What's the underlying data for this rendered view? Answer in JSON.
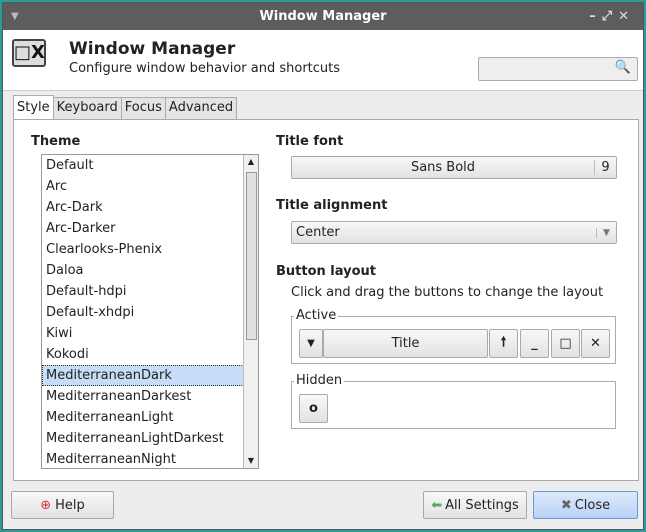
{
  "window": {
    "title": "Window Manager",
    "controls": [
      "–",
      "⤢",
      "✕"
    ]
  },
  "header": {
    "title": "Window Manager",
    "subtitle": "Configure window behavior and shortcuts",
    "search_placeholder": ""
  },
  "tabs": [
    {
      "label": "Style",
      "active": true
    },
    {
      "label": "Keyboard"
    },
    {
      "label": "Focus"
    },
    {
      "label": "Advanced"
    }
  ],
  "theme": {
    "label": "Theme",
    "items": [
      "Default",
      "Arc",
      "Arc-Dark",
      "Arc-Darker",
      "Clearlooks-Phenix",
      "Daloa",
      "Default-hdpi",
      "Default-xhdpi",
      "Kiwi",
      "Kokodi",
      "MediterraneanDark",
      "MediterraneanDarkest",
      "MediterraneanLight",
      "MediterraneanLightDarkest",
      "MediterraneanNight"
    ],
    "selected": "MediterraneanDark"
  },
  "title_font": {
    "label": "Title font",
    "font": "Sans Bold",
    "size": "9"
  },
  "title_alignment": {
    "label": "Title alignment",
    "value": "Center"
  },
  "button_layout": {
    "label": "Button layout",
    "description": "Click and drag the buttons to change the layout",
    "active_label": "Active",
    "hidden_label": "Hidden",
    "title_button": "Title"
  },
  "footer": {
    "help": "Help",
    "all_settings": "All Settings",
    "close": "Close"
  }
}
